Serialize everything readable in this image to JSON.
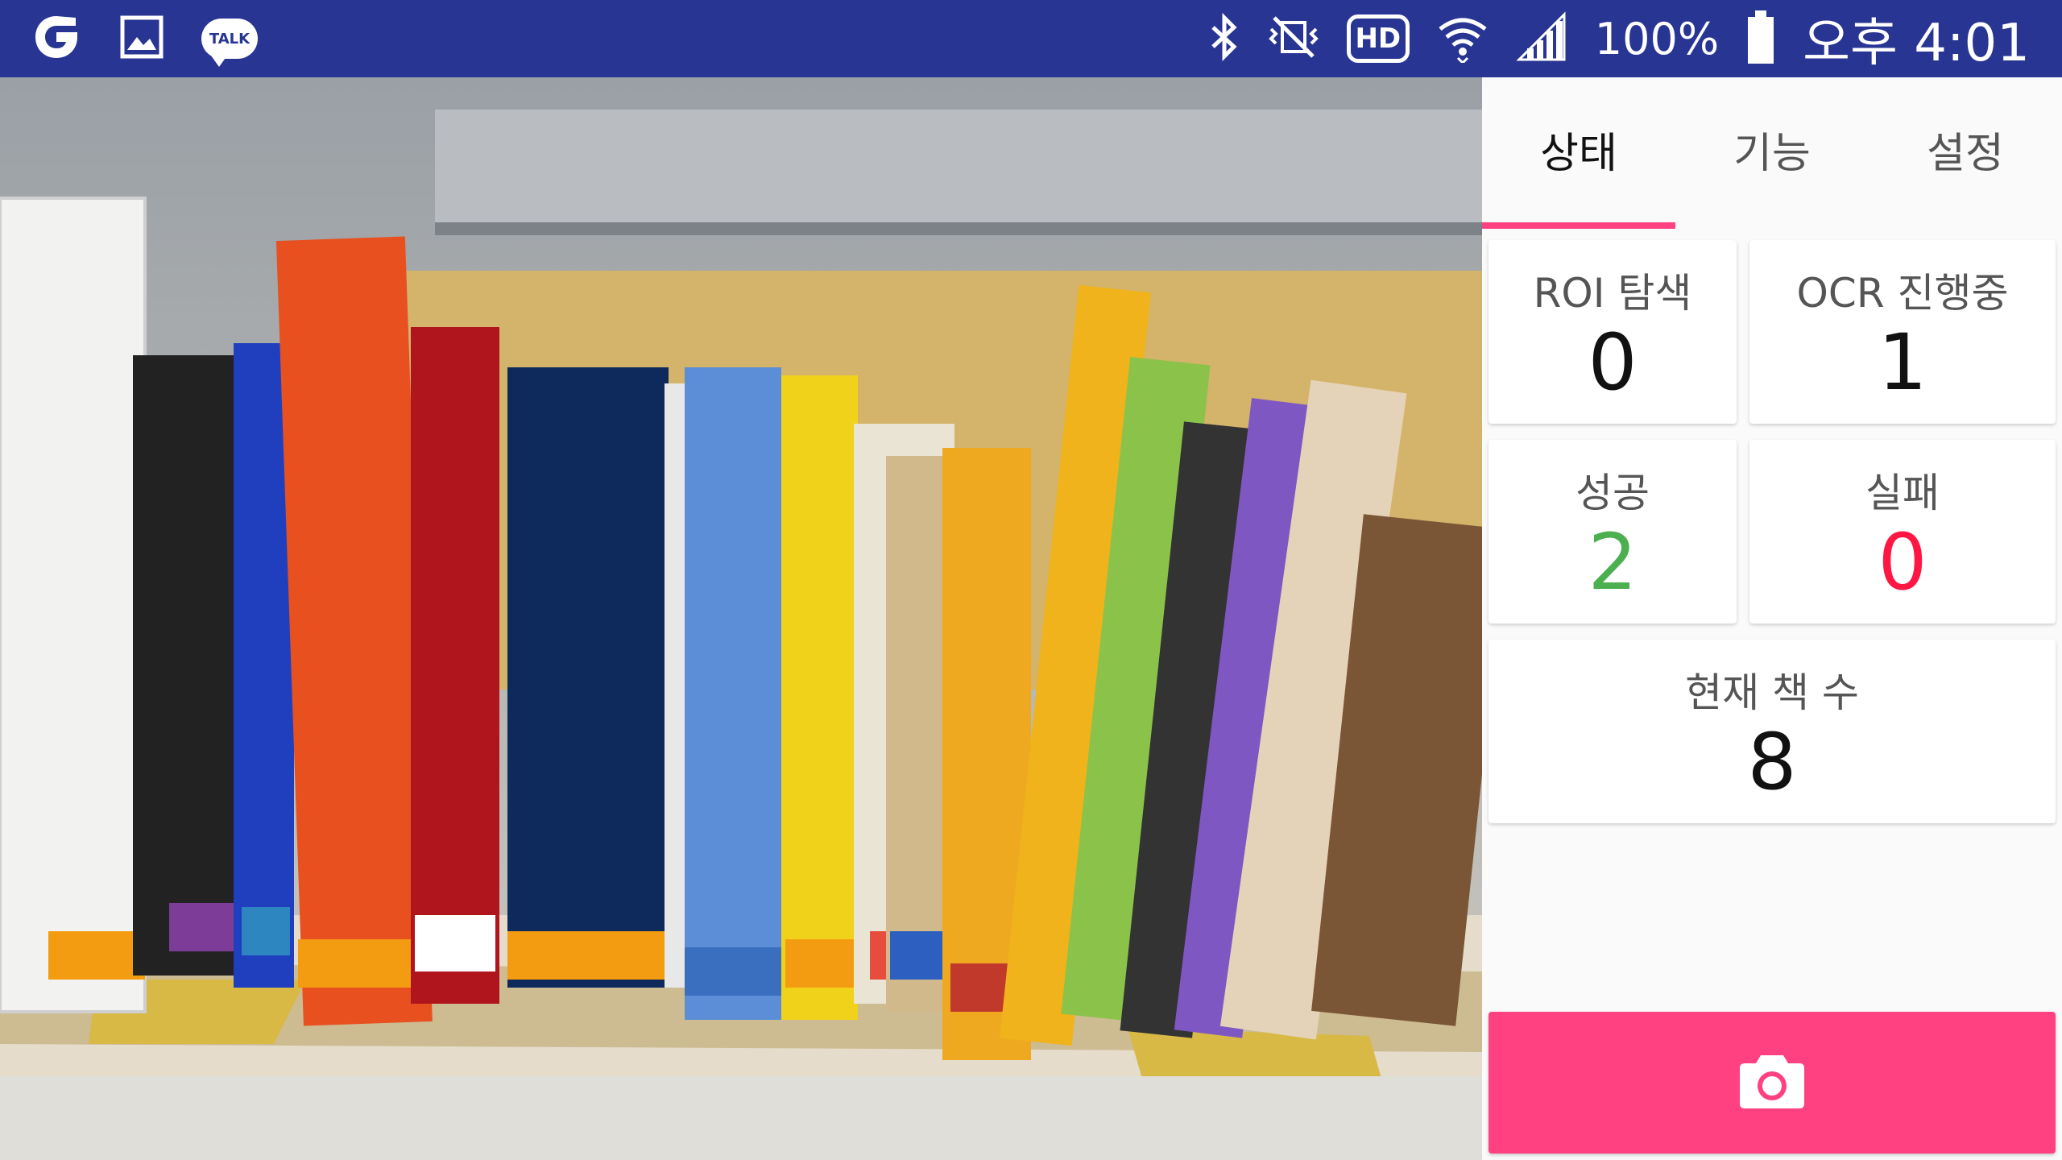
{
  "statusbar": {
    "battery": "100%",
    "time": "오후 4:01",
    "hd_label": "HD",
    "talk_label": "TALK",
    "icons": [
      "g-app-icon",
      "gallery-icon",
      "kakaotalk-icon",
      "bluetooth-icon",
      "vibrate-mute-icon",
      "hd-voice-icon",
      "wifi-icon",
      "signal-icon",
      "battery-icon"
    ]
  },
  "tabs": [
    {
      "label": "상태",
      "active": true
    },
    {
      "label": "기능",
      "active": false
    },
    {
      "label": "설정",
      "active": false
    }
  ],
  "stats": {
    "roi_label": "ROI 탐색",
    "roi_value": "0",
    "ocr_label": "OCR 진행중",
    "ocr_value": "1",
    "success_label": "성공",
    "success_value": "2",
    "fail_label": "실패",
    "fail_value": "0",
    "books_label": "현재 책 수",
    "books_value": "8"
  },
  "camera_button_icon": "camera-icon",
  "colors": {
    "statusbar": "#283593",
    "accent": "#ff4081",
    "success": "#4caf50",
    "fail": "#ff1744"
  }
}
